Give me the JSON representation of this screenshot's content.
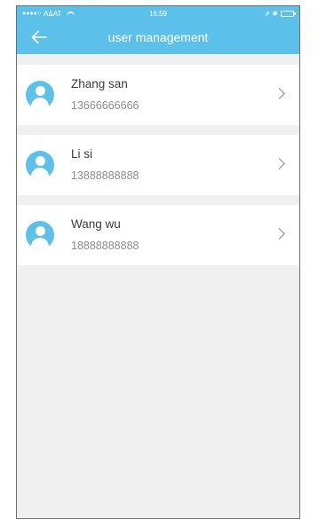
{
  "statusbar": {
    "signal_dots": "●●●●○",
    "carrier": "A&AT",
    "time": "16:59",
    "right_icons": "⇗ ✱"
  },
  "navbar": {
    "back_icon": "back-arrow-icon",
    "title": "user management"
  },
  "users": [
    {
      "name": "Zhang san",
      "phone": "13666666666"
    },
    {
      "name": "Li si",
      "phone": "13888888888"
    },
    {
      "name": "Wang wu",
      "phone": "18888888888"
    }
  ],
  "colors": {
    "accent": "#5bc0ea",
    "background": "#f0f0f0",
    "row": "#ffffff",
    "name_text": "#3a3a3a",
    "phone_text": "#8c8c8c"
  }
}
